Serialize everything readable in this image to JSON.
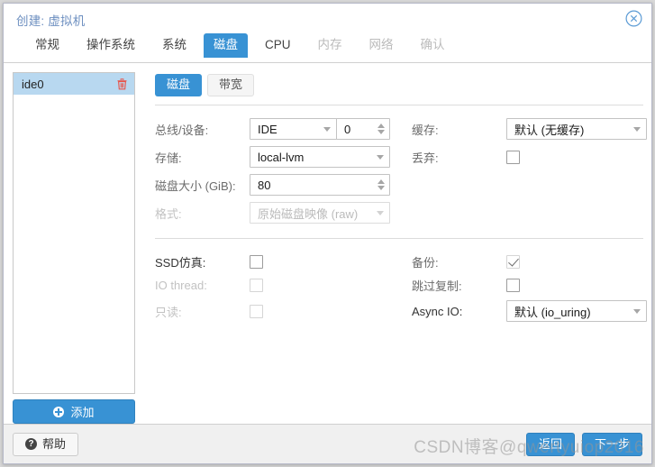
{
  "window": {
    "title": "创建: 虚拟机",
    "close_icon": "close-circle-icon"
  },
  "tabs": [
    {
      "label": "常规",
      "state": "normal"
    },
    {
      "label": "操作系统",
      "state": "normal"
    },
    {
      "label": "系统",
      "state": "normal"
    },
    {
      "label": "磁盘",
      "state": "active"
    },
    {
      "label": "CPU",
      "state": "normal"
    },
    {
      "label": "内存",
      "state": "disabled"
    },
    {
      "label": "网络",
      "state": "disabled"
    },
    {
      "label": "确认",
      "state": "disabled"
    }
  ],
  "device_list": {
    "items": [
      {
        "label": "ide0",
        "selected": true,
        "delete_icon": "trash-icon"
      }
    ],
    "add_button": {
      "label": "添加",
      "icon": "plus-circle-icon"
    }
  },
  "subtabs": [
    {
      "label": "磁盘",
      "state": "active"
    },
    {
      "label": "带宽",
      "state": "inactive"
    }
  ],
  "form": {
    "bus_device": {
      "label": "总线/设备:",
      "select_value": "IDE",
      "spin_value": "0"
    },
    "storage": {
      "label": "存储:",
      "value": "local-lvm"
    },
    "disk_size": {
      "label": "磁盘大小 (GiB):",
      "value": "80"
    },
    "format": {
      "label": "格式:",
      "value": "原始磁盘映像 (raw)",
      "disabled": true
    },
    "cache": {
      "label": "缓存:",
      "value": "默认 (无缓存)"
    },
    "discard": {
      "label": "丢弃:",
      "checked": false
    },
    "ssd_emulation": {
      "label": "SSD仿真:",
      "checked": false,
      "disabled": false
    },
    "io_thread": {
      "label": "IO thread:",
      "checked": false,
      "disabled": true
    },
    "readonly": {
      "label": "只读:",
      "checked": false,
      "disabled": true
    },
    "backup": {
      "label": "备份:",
      "checked": true
    },
    "skip_replication": {
      "label": "跳过复制:",
      "checked": false
    },
    "async_io": {
      "label": "Async IO:",
      "value": "默认 (io_uring)"
    }
  },
  "footer": {
    "help": {
      "label": "帮助",
      "icon": "question-circle-icon"
    },
    "back": {
      "label": "返回"
    },
    "next": {
      "label": "下一步"
    }
  },
  "watermark": {
    "text": "CSDN博客@qwertyuiop2016"
  }
}
